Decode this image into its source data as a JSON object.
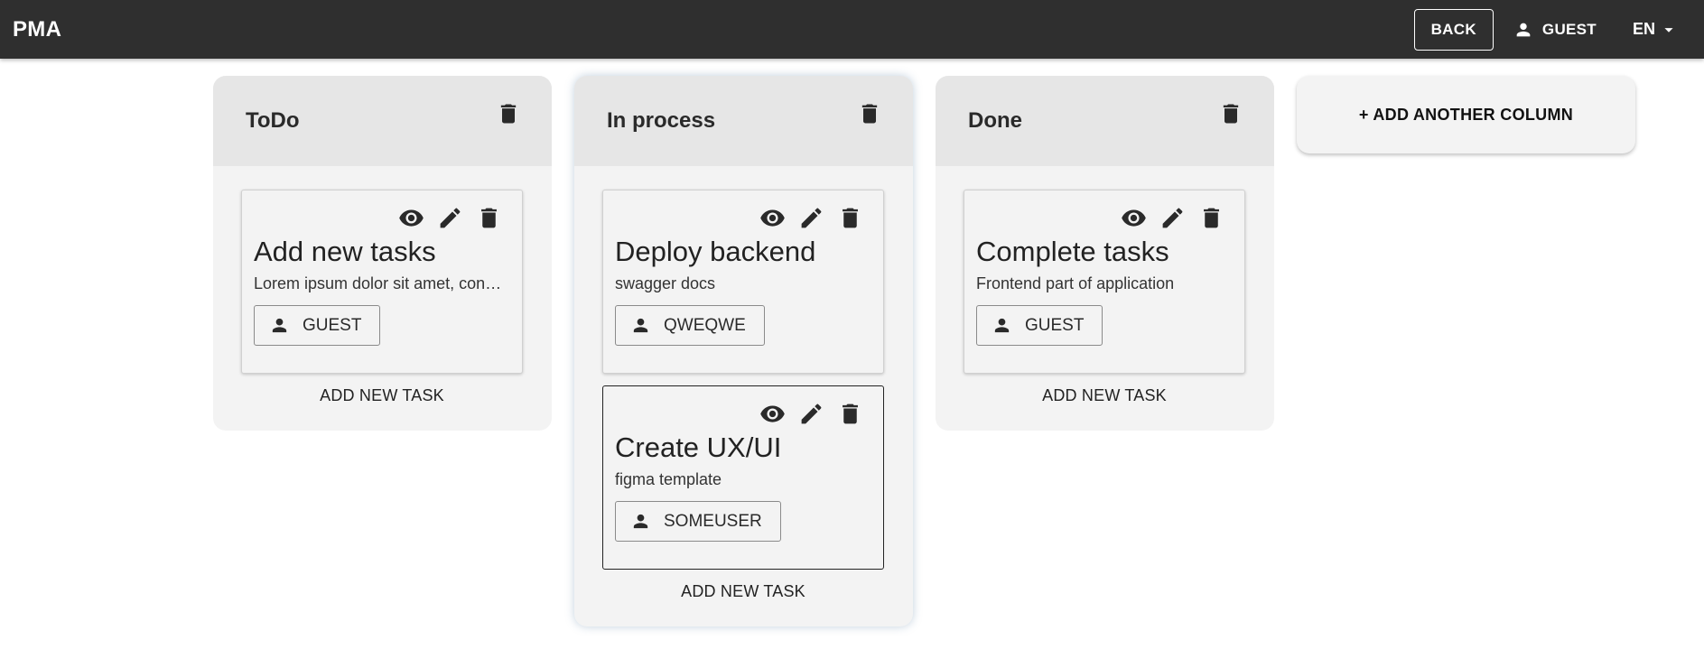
{
  "app": {
    "title": "PMA"
  },
  "header": {
    "back_label": "BACK",
    "user_label": "GUEST",
    "lang_label": "EN"
  },
  "board": {
    "add_column_label": "+ ADD ANOTHER COLUMN",
    "columns": [
      {
        "title": "ToDo",
        "add_task_label": "ADD NEW TASK",
        "tasks": [
          {
            "title": "Add new tasks",
            "description": "Lorem ipsum dolor sit amet, consectetur",
            "user": "GUEST"
          }
        ]
      },
      {
        "title": "In process",
        "add_task_label": "ADD NEW TASK",
        "tasks": [
          {
            "title": "Deploy backend",
            "description": "swagger docs",
            "user": "QWEQWE"
          },
          {
            "title": "Create UX/UI",
            "description": "figma template",
            "user": "SOMEUSER"
          }
        ]
      },
      {
        "title": "Done",
        "add_task_label": "ADD NEW TASK",
        "tasks": [
          {
            "title": "Complete tasks",
            "description": "Frontend part of application",
            "user": "GUEST"
          }
        ]
      }
    ]
  },
  "icons": {
    "trash": "trash-icon",
    "eye": "eye-icon",
    "pencil": "pencil-icon",
    "person": "person-icon",
    "caret": "caret-down-icon"
  },
  "colors": {
    "appbar": "#2f2f2f",
    "column_bg": "#f3f3f3",
    "column_header": "#e6e6e6"
  }
}
